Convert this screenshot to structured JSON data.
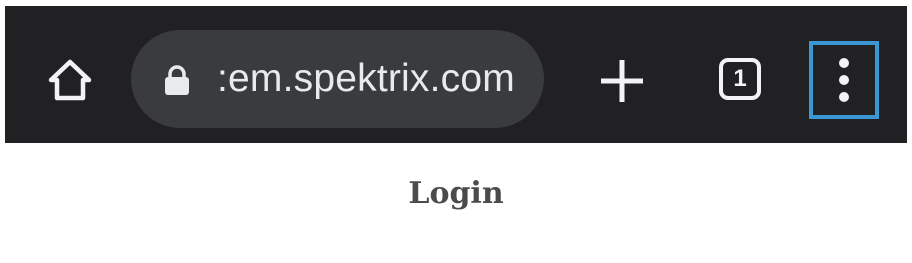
{
  "browser": {
    "url_text": ":em.spektrix.com",
    "tab_count": "1",
    "icons": {
      "home": "home-icon",
      "lock": "lock-icon",
      "new_tab": "plus-icon",
      "tab_switcher": "tab-switcher-icon",
      "menu": "more-vertical-icon"
    },
    "colors": {
      "toolbar_bg": "#212124",
      "omnibox_bg": "#3a3b3f",
      "icon_fg": "#f1f3f4",
      "highlight_border": "#3b97d3"
    }
  },
  "page": {
    "title": "Login"
  }
}
